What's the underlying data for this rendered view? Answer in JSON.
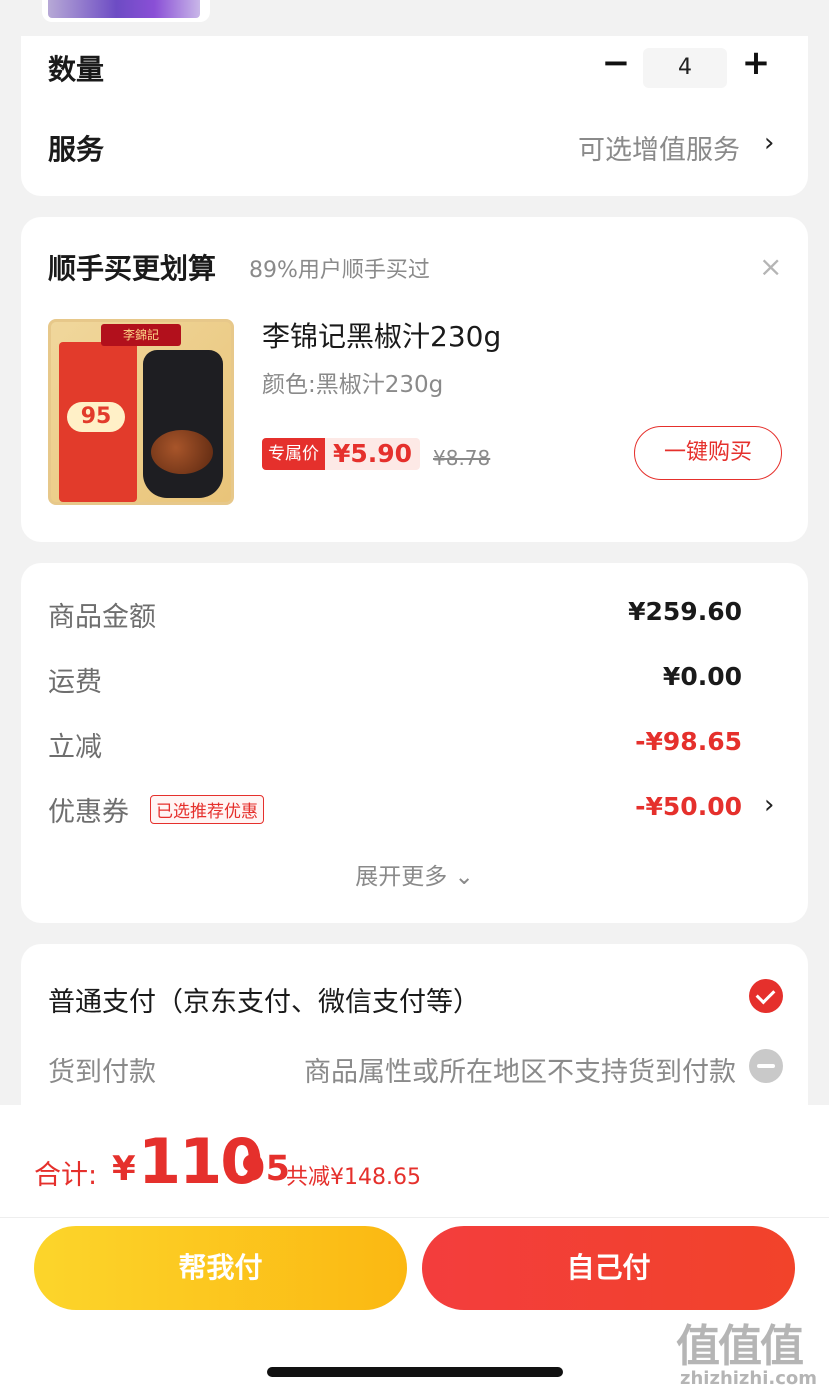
{
  "quantity": {
    "label": "数量",
    "value": "4",
    "minus": "−",
    "plus": "+"
  },
  "service": {
    "label": "服务",
    "value": "可选增值服务",
    "chevron": "›"
  },
  "addon": {
    "title": "顺手买更划算",
    "subtitle": "89%用户顺手买过",
    "close": "×",
    "product": {
      "name": "李锦记黑椒汁230g",
      "spec": "颜色:黑椒汁230g",
      "tag_label": "专属价",
      "price": "¥5.90",
      "original_price": "¥8.78",
      "image_badge": "95",
      "image_logo": "李錦記"
    },
    "buy_button": "一键购买"
  },
  "summary": {
    "rows": [
      {
        "label": "商品金额",
        "value": "¥259.60"
      },
      {
        "label": "运费",
        "value": "¥0.00"
      },
      {
        "label": "立减",
        "value": "-¥98.65"
      },
      {
        "label": "优惠券",
        "value": "-¥50.00",
        "tag": "已选推荐优惠"
      }
    ],
    "expand": "展开更多 ⌄",
    "chevron": "›"
  },
  "payment": {
    "normal": "普通支付（京东支付、微信支付等）",
    "cod_label": "货到付款",
    "cod_note": "商品属性或所在地区不支持货到付款"
  },
  "footer": {
    "total_label": "合计:",
    "currency": "¥",
    "total_int": "110",
    "total_dec": ".95",
    "saved": "共减¥148.65",
    "help_pay": "帮我付",
    "self_pay": "自己付"
  },
  "watermark": {
    "logo": "值值值",
    "site": "zhizhizhi.com"
  },
  "colors": {
    "accent": "#e5302c",
    "help_button": "#fcd52b",
    "self_button": "#f33d3d"
  }
}
